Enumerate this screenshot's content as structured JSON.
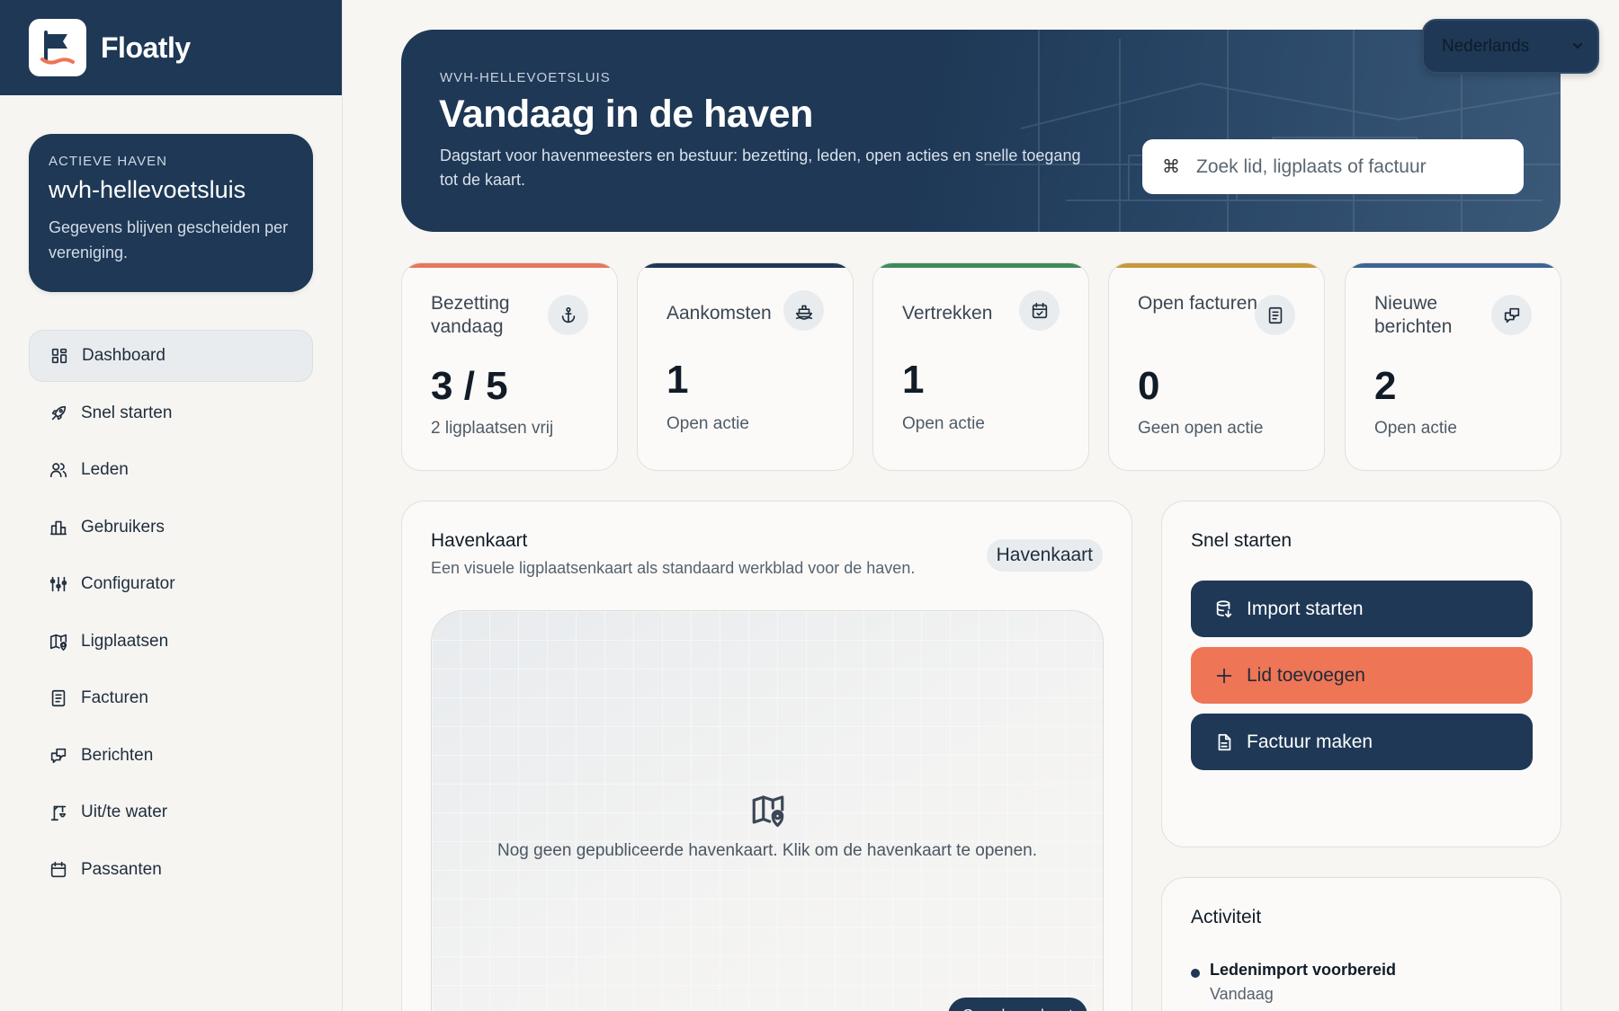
{
  "app": {
    "name": "Floatly"
  },
  "active_haven": {
    "label": "ACTIEVE HAVEN",
    "name": "wvh-hellevoetsluis",
    "note": "Gegevens blijven gescheiden per vereniging."
  },
  "sidebar": {
    "items": [
      {
        "label": "Dashboard",
        "icon": "dashboard-icon",
        "active": true
      },
      {
        "label": "Snel starten",
        "icon": "rocket-icon"
      },
      {
        "label": "Leden",
        "icon": "users-icon"
      },
      {
        "label": "Gebruikers",
        "icon": "building-icon"
      },
      {
        "label": "Configurator",
        "icon": "sliders-icon"
      },
      {
        "label": "Ligplaatsen",
        "icon": "map-pin-icon"
      },
      {
        "label": "Facturen",
        "icon": "receipt-icon"
      },
      {
        "label": "Berichten",
        "icon": "messages-icon"
      },
      {
        "label": "Uit/te water",
        "icon": "crane-icon"
      },
      {
        "label": "Passanten",
        "icon": "calendar-icon"
      }
    ]
  },
  "language": {
    "selected": "Nederlands"
  },
  "hero": {
    "kicker": "WVH-HELLEVOETSLUIS",
    "title": "Vandaag in de haven",
    "subtitle": "Dagstart voor havenmeesters en bestuur: bezetting, leden, open acties en snelle toegang tot de kaart.",
    "search_shortcut": "⌘",
    "search_placeholder": "Zoek lid, ligplaats of factuur"
  },
  "stats": [
    {
      "title": "Bezetting vandaag",
      "value": "3 / 5",
      "sub": "2 ligplaatsen vrij",
      "icon": "anchor-icon",
      "color": "#e8775a"
    },
    {
      "title": "Aankomsten",
      "value": "1",
      "sub": "Open actie",
      "icon": "ship-icon",
      "color": "#1e3856"
    },
    {
      "title": "Vertrekken",
      "value": "1",
      "sub": "Open actie",
      "icon": "calendar-check-icon",
      "color": "#3f8a5c"
    },
    {
      "title": "Open facturen",
      "value": "0",
      "sub": "Geen open actie",
      "icon": "receipt-icon",
      "color": "#c99a3a"
    },
    {
      "title": "Nieuwe berichten",
      "value": "2",
      "sub": "Open actie",
      "icon": "messages-icon",
      "color": "#3d6494"
    }
  ],
  "map_panel": {
    "title": "Havenkaart",
    "subtitle": "Een visuele ligplaatsenkaart als standaard werkblad voor de haven.",
    "pill": "Havenkaart",
    "empty_text": "Nog geen gepubliceerde havenkaart. Klik om de havenkaart te openen.",
    "open_button": "Open havenkaart"
  },
  "quick_start": {
    "title": "Snel starten",
    "buttons": [
      {
        "label": "Import starten",
        "icon": "database-import-icon",
        "style": "navy"
      },
      {
        "label": "Lid toevoegen",
        "icon": "plus-icon",
        "style": "orange"
      },
      {
        "label": "Factuur maken",
        "icon": "file-icon",
        "style": "navy"
      }
    ]
  },
  "activity": {
    "title": "Activiteit",
    "items": [
      {
        "title": "Ledenimport voorbereid",
        "time": "Vandaag"
      }
    ]
  },
  "colors": {
    "navy": "#1e3856",
    "accent": "#ee7555",
    "background": "#f7f6f3"
  }
}
